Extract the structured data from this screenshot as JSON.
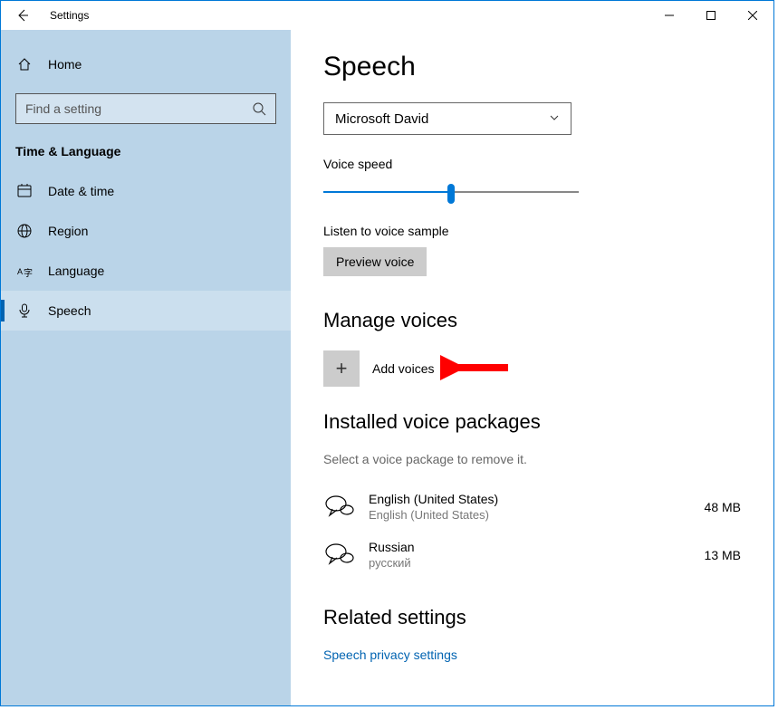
{
  "titlebar": {
    "app_title": "Settings"
  },
  "sidebar": {
    "home_label": "Home",
    "search_placeholder": "Find a setting",
    "category": "Time & Language",
    "items": [
      {
        "label": "Date & time"
      },
      {
        "label": "Region"
      },
      {
        "label": "Language"
      },
      {
        "label": "Speech"
      }
    ]
  },
  "content": {
    "page_title": "Speech",
    "voice_dropdown": "Microsoft David",
    "voice_speed_label": "Voice speed",
    "voice_sample_label": "Listen to voice sample",
    "preview_button": "Preview voice",
    "manage_voices_heading": "Manage voices",
    "add_voices_label": "Add voices",
    "installed_heading": "Installed voice packages",
    "installed_hint": "Select a voice package to remove it.",
    "packages": [
      {
        "name": "English (United States)",
        "native": "English (United States)",
        "size": "48 MB"
      },
      {
        "name": "Russian",
        "native": "русский",
        "size": "13 MB"
      }
    ],
    "related_heading": "Related settings",
    "privacy_link": "Speech privacy settings"
  }
}
